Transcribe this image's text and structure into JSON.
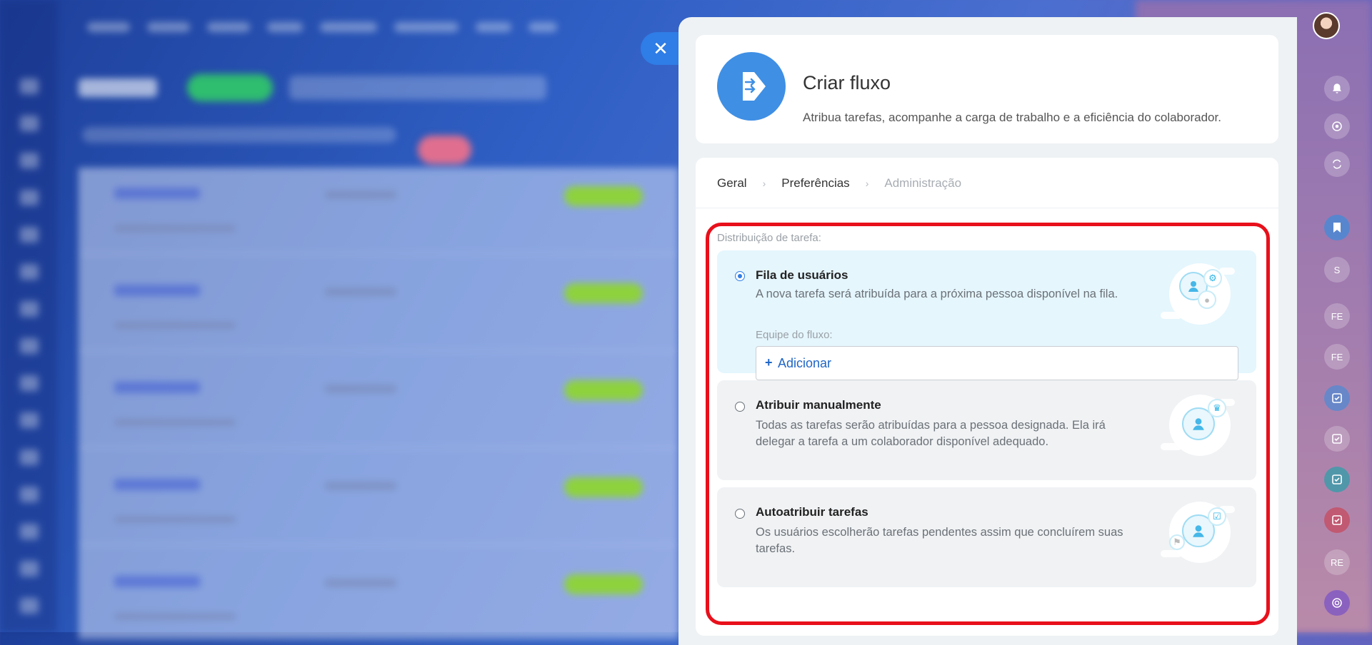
{
  "panel": {
    "title": "Criar fluxo",
    "subtitle": "Atribua tarefas, acompanhe a carga de trabalho e a eficiência do colaborador."
  },
  "steps": [
    {
      "label": "Geral",
      "state": "done"
    },
    {
      "label": "Preferências",
      "state": "active"
    },
    {
      "label": "Administração",
      "state": "disabled"
    }
  ],
  "distribution": {
    "label": "Distribuição de tarefa:",
    "options": [
      {
        "title": "Fila de usuários",
        "description": "A nova tarefa será atribuída para a próxima pessoa disponível na fila.",
        "selected": true,
        "team_label": "Equipe do fluxo:",
        "add_label": "Adicionar"
      },
      {
        "title": "Atribuir manualmente",
        "description": "Todas as tarefas serão atribuídas para a pessoa designada. Ela irá delegar a tarefa a um colaborador disponível adequado.",
        "selected": false
      },
      {
        "title": "Autoatribuir tarefas",
        "description": "Os usuários escolherão tarefas pendentes assim que concluírem suas tarefas.",
        "selected": false
      }
    ]
  },
  "right_bar": {
    "initials": [
      "S",
      "FE",
      "FE",
      "RE"
    ]
  },
  "colors": {
    "accent": "#2f7de6",
    "selected_bg": "#e5f6fd",
    "highlight": "#e8101b",
    "link": "#2066c6"
  },
  "icons": {
    "close": "close-icon",
    "flow": "flow-icon",
    "bell": "bell-icon",
    "chevron": "chevron-right-icon"
  }
}
